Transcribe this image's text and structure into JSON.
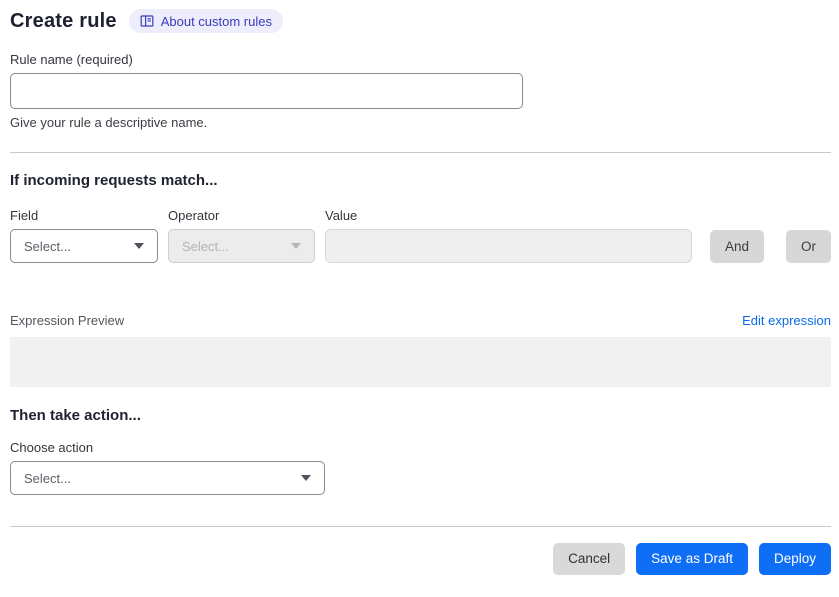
{
  "header": {
    "title": "Create rule",
    "about_badge_label": "About custom rules"
  },
  "rule_name": {
    "label": "Rule name (required)",
    "value": "",
    "helper": "Give your rule a descriptive name."
  },
  "match_section": {
    "heading": "If incoming requests match...",
    "field": {
      "label": "Field",
      "selected": "Select..."
    },
    "operator": {
      "label": "Operator",
      "selected": "Select..."
    },
    "value": {
      "label": "Value",
      "value": ""
    },
    "and_button": "And",
    "or_button": "Or",
    "expression_preview_label": "Expression Preview",
    "edit_expression_link": "Edit expression",
    "expression_value": ""
  },
  "action_section": {
    "heading": "Then take action...",
    "choose_action": {
      "label": "Choose action",
      "selected": "Select..."
    }
  },
  "footer": {
    "cancel": "Cancel",
    "save_draft": "Save as Draft",
    "deploy": "Deploy"
  },
  "colors": {
    "accent_blue": "#0e6ef6",
    "link_blue": "#0b6ce8",
    "badge_bg": "#eeedfb",
    "badge_text": "#3c3cbe",
    "disabled_bg": "#ececec",
    "neutral_button_bg": "#d9d9d9"
  }
}
